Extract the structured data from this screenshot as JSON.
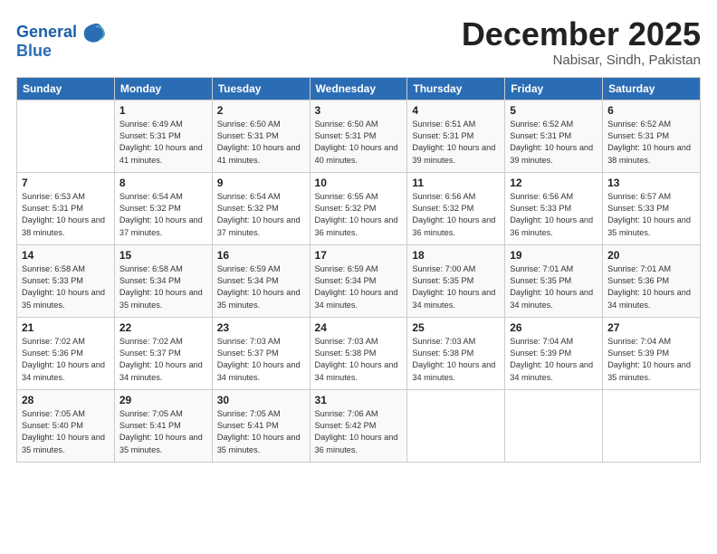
{
  "logo": {
    "line1": "General",
    "line2": "Blue"
  },
  "title": "December 2025",
  "location": "Nabisar, Sindh, Pakistan",
  "headers": [
    "Sunday",
    "Monday",
    "Tuesday",
    "Wednesday",
    "Thursday",
    "Friday",
    "Saturday"
  ],
  "weeks": [
    [
      {
        "day": "",
        "sunrise": "",
        "sunset": "",
        "daylight": ""
      },
      {
        "day": "1",
        "sunrise": "Sunrise: 6:49 AM",
        "sunset": "Sunset: 5:31 PM",
        "daylight": "Daylight: 10 hours and 41 minutes."
      },
      {
        "day": "2",
        "sunrise": "Sunrise: 6:50 AM",
        "sunset": "Sunset: 5:31 PM",
        "daylight": "Daylight: 10 hours and 41 minutes."
      },
      {
        "day": "3",
        "sunrise": "Sunrise: 6:50 AM",
        "sunset": "Sunset: 5:31 PM",
        "daylight": "Daylight: 10 hours and 40 minutes."
      },
      {
        "day": "4",
        "sunrise": "Sunrise: 6:51 AM",
        "sunset": "Sunset: 5:31 PM",
        "daylight": "Daylight: 10 hours and 39 minutes."
      },
      {
        "day": "5",
        "sunrise": "Sunrise: 6:52 AM",
        "sunset": "Sunset: 5:31 PM",
        "daylight": "Daylight: 10 hours and 39 minutes."
      },
      {
        "day": "6",
        "sunrise": "Sunrise: 6:52 AM",
        "sunset": "Sunset: 5:31 PM",
        "daylight": "Daylight: 10 hours and 38 minutes."
      }
    ],
    [
      {
        "day": "7",
        "sunrise": "Sunrise: 6:53 AM",
        "sunset": "Sunset: 5:31 PM",
        "daylight": "Daylight: 10 hours and 38 minutes."
      },
      {
        "day": "8",
        "sunrise": "Sunrise: 6:54 AM",
        "sunset": "Sunset: 5:32 PM",
        "daylight": "Daylight: 10 hours and 37 minutes."
      },
      {
        "day": "9",
        "sunrise": "Sunrise: 6:54 AM",
        "sunset": "Sunset: 5:32 PM",
        "daylight": "Daylight: 10 hours and 37 minutes."
      },
      {
        "day": "10",
        "sunrise": "Sunrise: 6:55 AM",
        "sunset": "Sunset: 5:32 PM",
        "daylight": "Daylight: 10 hours and 36 minutes."
      },
      {
        "day": "11",
        "sunrise": "Sunrise: 6:56 AM",
        "sunset": "Sunset: 5:32 PM",
        "daylight": "Daylight: 10 hours and 36 minutes."
      },
      {
        "day": "12",
        "sunrise": "Sunrise: 6:56 AM",
        "sunset": "Sunset: 5:33 PM",
        "daylight": "Daylight: 10 hours and 36 minutes."
      },
      {
        "day": "13",
        "sunrise": "Sunrise: 6:57 AM",
        "sunset": "Sunset: 5:33 PM",
        "daylight": "Daylight: 10 hours and 35 minutes."
      }
    ],
    [
      {
        "day": "14",
        "sunrise": "Sunrise: 6:58 AM",
        "sunset": "Sunset: 5:33 PM",
        "daylight": "Daylight: 10 hours and 35 minutes."
      },
      {
        "day": "15",
        "sunrise": "Sunrise: 6:58 AM",
        "sunset": "Sunset: 5:34 PM",
        "daylight": "Daylight: 10 hours and 35 minutes."
      },
      {
        "day": "16",
        "sunrise": "Sunrise: 6:59 AM",
        "sunset": "Sunset: 5:34 PM",
        "daylight": "Daylight: 10 hours and 35 minutes."
      },
      {
        "day": "17",
        "sunrise": "Sunrise: 6:59 AM",
        "sunset": "Sunset: 5:34 PM",
        "daylight": "Daylight: 10 hours and 34 minutes."
      },
      {
        "day": "18",
        "sunrise": "Sunrise: 7:00 AM",
        "sunset": "Sunset: 5:35 PM",
        "daylight": "Daylight: 10 hours and 34 minutes."
      },
      {
        "day": "19",
        "sunrise": "Sunrise: 7:01 AM",
        "sunset": "Sunset: 5:35 PM",
        "daylight": "Daylight: 10 hours and 34 minutes."
      },
      {
        "day": "20",
        "sunrise": "Sunrise: 7:01 AM",
        "sunset": "Sunset: 5:36 PM",
        "daylight": "Daylight: 10 hours and 34 minutes."
      }
    ],
    [
      {
        "day": "21",
        "sunrise": "Sunrise: 7:02 AM",
        "sunset": "Sunset: 5:36 PM",
        "daylight": "Daylight: 10 hours and 34 minutes."
      },
      {
        "day": "22",
        "sunrise": "Sunrise: 7:02 AM",
        "sunset": "Sunset: 5:37 PM",
        "daylight": "Daylight: 10 hours and 34 minutes."
      },
      {
        "day": "23",
        "sunrise": "Sunrise: 7:03 AM",
        "sunset": "Sunset: 5:37 PM",
        "daylight": "Daylight: 10 hours and 34 minutes."
      },
      {
        "day": "24",
        "sunrise": "Sunrise: 7:03 AM",
        "sunset": "Sunset: 5:38 PM",
        "daylight": "Daylight: 10 hours and 34 minutes."
      },
      {
        "day": "25",
        "sunrise": "Sunrise: 7:03 AM",
        "sunset": "Sunset: 5:38 PM",
        "daylight": "Daylight: 10 hours and 34 minutes."
      },
      {
        "day": "26",
        "sunrise": "Sunrise: 7:04 AM",
        "sunset": "Sunset: 5:39 PM",
        "daylight": "Daylight: 10 hours and 34 minutes."
      },
      {
        "day": "27",
        "sunrise": "Sunrise: 7:04 AM",
        "sunset": "Sunset: 5:39 PM",
        "daylight": "Daylight: 10 hours and 35 minutes."
      }
    ],
    [
      {
        "day": "28",
        "sunrise": "Sunrise: 7:05 AM",
        "sunset": "Sunset: 5:40 PM",
        "daylight": "Daylight: 10 hours and 35 minutes."
      },
      {
        "day": "29",
        "sunrise": "Sunrise: 7:05 AM",
        "sunset": "Sunset: 5:41 PM",
        "daylight": "Daylight: 10 hours and 35 minutes."
      },
      {
        "day": "30",
        "sunrise": "Sunrise: 7:05 AM",
        "sunset": "Sunset: 5:41 PM",
        "daylight": "Daylight: 10 hours and 35 minutes."
      },
      {
        "day": "31",
        "sunrise": "Sunrise: 7:06 AM",
        "sunset": "Sunset: 5:42 PM",
        "daylight": "Daylight: 10 hours and 36 minutes."
      },
      {
        "day": "",
        "sunrise": "",
        "sunset": "",
        "daylight": ""
      },
      {
        "day": "",
        "sunrise": "",
        "sunset": "",
        "daylight": ""
      },
      {
        "day": "",
        "sunrise": "",
        "sunset": "",
        "daylight": ""
      }
    ]
  ]
}
